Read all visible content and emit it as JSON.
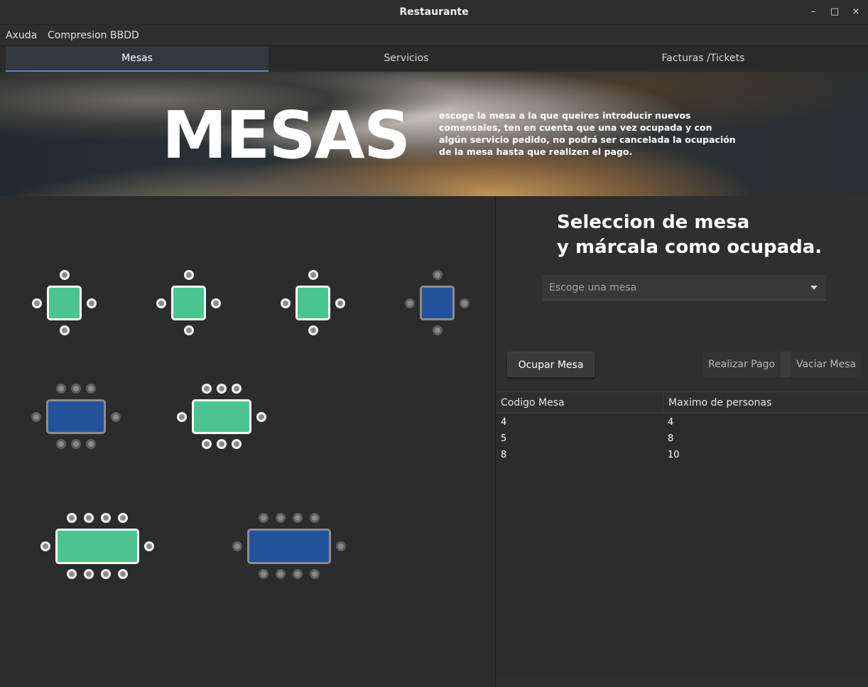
{
  "window": {
    "title": "Restaurante"
  },
  "menu": {
    "items": [
      "Axuda",
      "Compresion BBDD"
    ]
  },
  "tabs": [
    "Mesas",
    "Servicios",
    "Facturas /Tickets"
  ],
  "banner": {
    "title": "MESAS",
    "description": "escoge la mesa a la que queires introducir nuevos comensales, ten en cuenta que una vez ocupada y con algún servicio pedido, no podrá ser cancelada la ocupación de la mesa hasta que realizen el pago."
  },
  "panel": {
    "heading_line1": "Seleccion de mesa",
    "heading_line2": "y márcala como ocupada.",
    "combo_placeholder": "Escoge una mesa",
    "buttons": {
      "ocupar": "Ocupar Mesa",
      "pago": "Realizar Pago",
      "vaciar": "Vaciar Mesa"
    }
  },
  "grid": {
    "columns": [
      "Codigo Mesa",
      "Maximo de personas"
    ],
    "rows": [
      [
        "4",
        "4"
      ],
      [
        "5",
        "8"
      ],
      [
        "8",
        "10"
      ]
    ]
  },
  "colors": {
    "free": "#4bc58f",
    "busy": "#22529a",
    "accent": "#4f86d9"
  },
  "tables": [
    {
      "seats": 4,
      "status": "free"
    },
    {
      "seats": 4,
      "status": "free"
    },
    {
      "seats": 4,
      "status": "free"
    },
    {
      "seats": 4,
      "status": "busy"
    },
    {
      "seats": 8,
      "status": "busy"
    },
    {
      "seats": 8,
      "status": "free"
    },
    {
      "seats": 10,
      "status": "free"
    },
    {
      "seats": 10,
      "status": "busy"
    }
  ]
}
